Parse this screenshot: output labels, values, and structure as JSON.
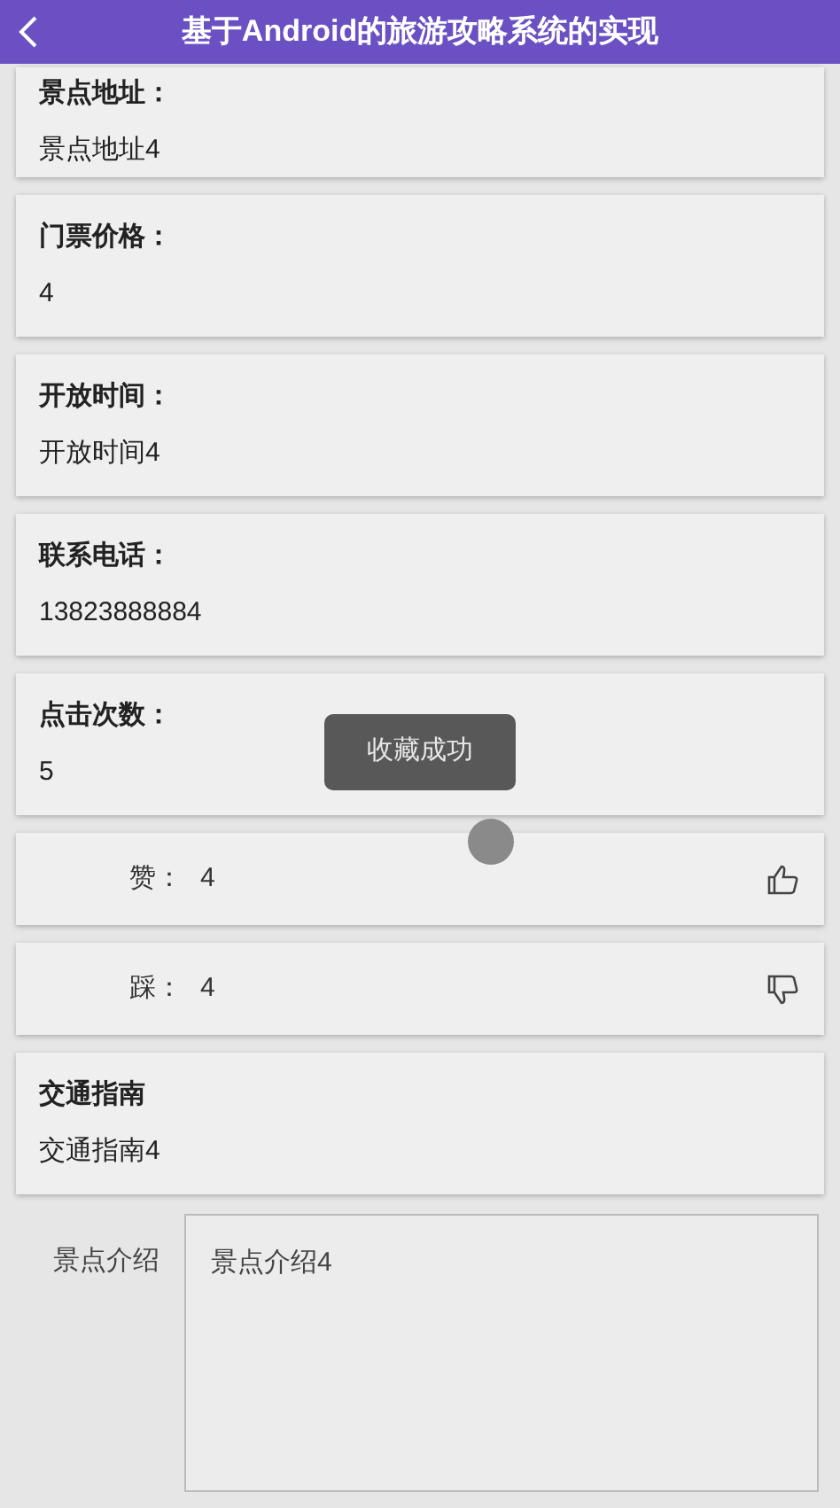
{
  "header": {
    "title": "基于Android的旅游攻略系统的实现"
  },
  "fields": [
    {
      "kind": "info",
      "label": "景点地址：",
      "value": "景点地址4"
    },
    {
      "kind": "info",
      "label": "门票价格：",
      "value": "4"
    },
    {
      "kind": "info",
      "label": "开放时间：",
      "value": "开放时间4"
    },
    {
      "kind": "info",
      "label": "联系电话：",
      "value": "13823888884"
    },
    {
      "kind": "info",
      "label": "点击次数：",
      "value": "5"
    },
    {
      "kind": "like",
      "label": "赞：",
      "value": "4"
    },
    {
      "kind": "dislike",
      "label": "踩：",
      "value": "4"
    },
    {
      "kind": "info",
      "label": "交通指南",
      "value": "交通指南4"
    },
    {
      "kind": "textarea",
      "label": "景点介绍",
      "value": "景点介绍4"
    }
  ],
  "toast": {
    "text": "收藏成功"
  }
}
